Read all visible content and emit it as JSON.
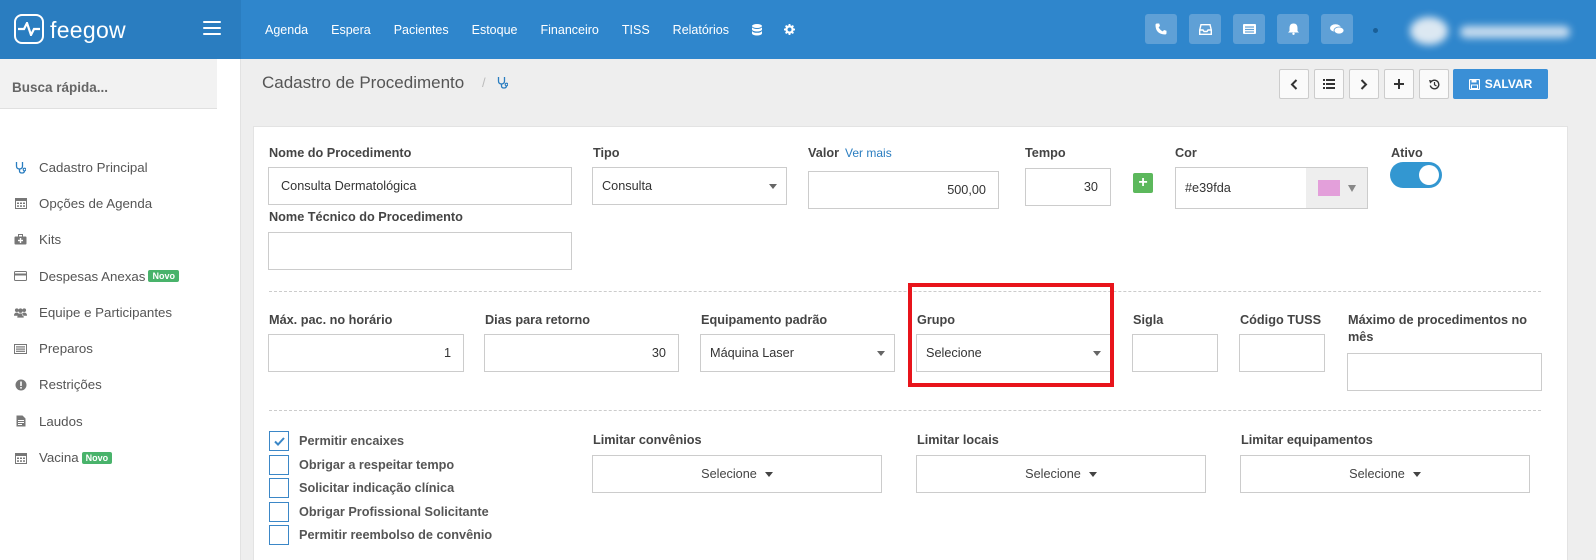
{
  "brand": {
    "name": "feegow"
  },
  "nav": {
    "items": [
      "Agenda",
      "Espera",
      "Pacientes",
      "Estoque",
      "Financeiro",
      "TISS",
      "Relatórios"
    ],
    "icons": [
      "database-icon",
      "gear-icon"
    ]
  },
  "topbar": {
    "buttons": [
      "phone-icon",
      "inbox-icon",
      "list-icon",
      "bell-icon",
      "chat-icon"
    ]
  },
  "sidebar": {
    "search_label": "Busca rápida...",
    "items": [
      {
        "label": "Cadastro Principal",
        "icon": "stethoscope-icon",
        "badge": ""
      },
      {
        "label": "Opções de Agenda",
        "icon": "calendar-icon",
        "badge": ""
      },
      {
        "label": "Kits",
        "icon": "medkit-icon",
        "badge": ""
      },
      {
        "label": "Despesas Anexas",
        "icon": "credit-card-icon",
        "badge": "Novo"
      },
      {
        "label": "Equipe e Participantes",
        "icon": "users-icon",
        "badge": ""
      },
      {
        "label": "Preparos",
        "icon": "list-alt-icon",
        "badge": ""
      },
      {
        "label": "Restrições",
        "icon": "exclamation-icon",
        "badge": ""
      },
      {
        "label": "Laudos",
        "icon": "file-icon",
        "badge": ""
      },
      {
        "label": "Vacina",
        "icon": "calendar-icon",
        "badge": "Novo"
      }
    ]
  },
  "header": {
    "title": "Cadastro de Procedimento",
    "save_label": "SALVAR"
  },
  "form": {
    "nome": {
      "label": "Nome do Procedimento",
      "value": "Consulta Dermatológica"
    },
    "tipo": {
      "label": "Tipo",
      "value": "Consulta"
    },
    "valor": {
      "label": "Valor",
      "link": "Ver mais",
      "value": "500,00"
    },
    "tempo": {
      "label": "Tempo",
      "value": "30"
    },
    "cor": {
      "label": "Cor",
      "value": "#e39fda",
      "swatch": "#e39fda"
    },
    "ativo": {
      "label": "Ativo",
      "on": true
    },
    "nome_tecnico": {
      "label": "Nome Técnico do Procedimento",
      "value": ""
    },
    "max_pac": {
      "label": "Máx. pac. no horário",
      "value": "1"
    },
    "dias_retorno": {
      "label": "Dias para retorno",
      "value": "30"
    },
    "equipamento": {
      "label": "Equipamento padrão",
      "value": "Máquina Laser"
    },
    "grupo": {
      "label": "Grupo",
      "value": "Selecione"
    },
    "sigla": {
      "label": "Sigla",
      "value": ""
    },
    "codigo_tuss": {
      "label": "Código TUSS",
      "value": ""
    },
    "max_proc": {
      "label": "Máximo de procedimentos no mês",
      "value": ""
    },
    "checkboxes": [
      {
        "label": "Permitir encaixes",
        "checked": true
      },
      {
        "label": "Obrigar a respeitar tempo",
        "checked": false
      },
      {
        "label": "Solicitar indicação clínica",
        "checked": false
      },
      {
        "label": "Obrigar Profissional Solicitante",
        "checked": false
      },
      {
        "label": "Permitir reembolso de convênio",
        "checked": false
      }
    ],
    "limitar_convenios": {
      "label": "Limitar convênios",
      "value": "Selecione"
    },
    "limitar_locais": {
      "label": "Limitar locais",
      "value": "Selecione"
    },
    "limitar_equipamentos": {
      "label": "Limitar equipamentos",
      "value": "Selecione"
    }
  },
  "colors": {
    "topbar": "#2f86cc",
    "accent": "#3a8fd6",
    "highlight": "#e8141b",
    "badge": "#49b36b"
  }
}
